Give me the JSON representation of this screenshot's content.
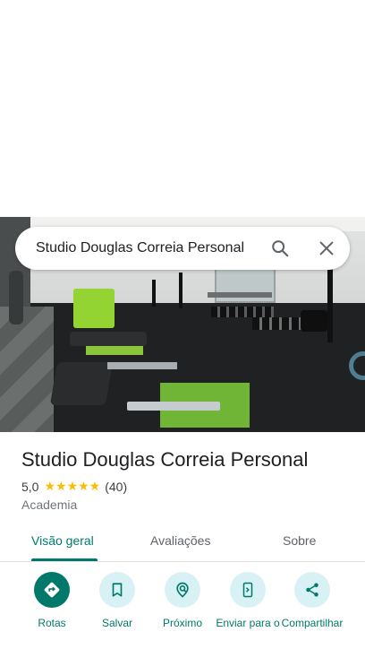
{
  "search": {
    "query": "Studio Douglas Correia Personal"
  },
  "place": {
    "name": "Studio Douglas Correia Personal",
    "rating": "5,0",
    "stars": "★★★★★",
    "review_count": "(40)",
    "category": "Academia"
  },
  "tabs": [
    {
      "label": "Visão geral",
      "active": true
    },
    {
      "label": "Avaliações",
      "active": false
    },
    {
      "label": "Sobre",
      "active": false
    }
  ],
  "actions": [
    {
      "label": "Rotas",
      "icon": "directions-icon"
    },
    {
      "label": "Salvar",
      "icon": "bookmark-icon"
    },
    {
      "label": "Próximo",
      "icon": "nearby-icon"
    },
    {
      "label": "Enviar para o",
      "icon": "send-to-phone-icon"
    },
    {
      "label": "Compartilhar",
      "icon": "share-icon"
    }
  ],
  "colors": {
    "accent": "#00796b",
    "action_bg": "#d8f1f4",
    "star": "#fbbc04"
  }
}
